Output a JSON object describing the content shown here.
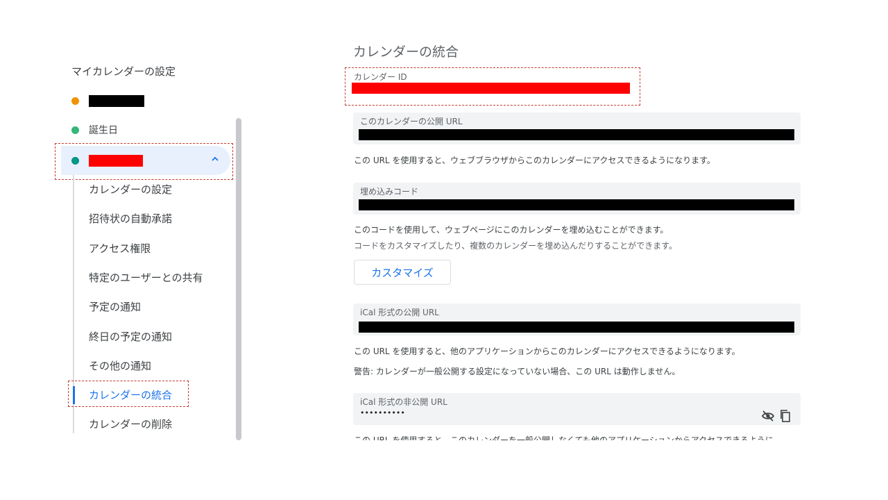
{
  "sidebar": {
    "title": "マイカレンダーの設定",
    "calendars": [
      {
        "label": "",
        "color": "#f09300",
        "redacted": "black"
      },
      {
        "label": "誕生日",
        "color": "#33b679"
      },
      {
        "label": "",
        "color": "#009688",
        "redacted": "red",
        "expanded": true
      }
    ],
    "sub_items": [
      "カレンダーの設定",
      "招待状の自動承諾",
      "アクセス権限",
      "特定のユーザーとの共有",
      "予定の通知",
      "終日の予定の通知",
      "その他の通知",
      "カレンダーの統合",
      "カレンダーの削除"
    ],
    "selected_item": "カレンダーの統合"
  },
  "main": {
    "section_title": "カレンダーの統合",
    "calendar_id": {
      "label": "カレンダー ID",
      "value_redacted": true
    },
    "public_url": {
      "label": "このカレンダーの公開 URL",
      "help": "この URL を使用すると、ウェブブラウザからこのカレンダーにアクセスできるようになります。"
    },
    "embed_code": {
      "label": "埋め込みコード",
      "help": "このコードを使用して、ウェブページにこのカレンダーを埋め込むことができます。",
      "help_sub": "コードをカスタマイズしたり、複数のカレンダーを埋め込んだりすることができます。",
      "customize_label": "カスタマイズ"
    },
    "ical_public": {
      "label": "iCal 形式の公開 URL",
      "help": "この URL を使用すると、他のアプリケーションからこのカレンダーにアクセスできるようになります。",
      "warning": "警告: カレンダーが一般公開する設定になっていない場合、この URL は動作しません。"
    },
    "ical_private": {
      "label": "iCal 形式の非公開 URL",
      "masked_value": "••••••••••",
      "help_cut": "この URL を使用すると、このカレンダーを一般公開しなくても他のアプリケーションからアクセスできるように"
    }
  },
  "colors": {
    "accent": "#1a73e8",
    "redaction_red": "#ff0000",
    "annotation": "#c0392b"
  },
  "icons": {
    "expand": "chevron-up-icon",
    "visibility": "eye-off-icon",
    "copy": "copy-icon"
  }
}
